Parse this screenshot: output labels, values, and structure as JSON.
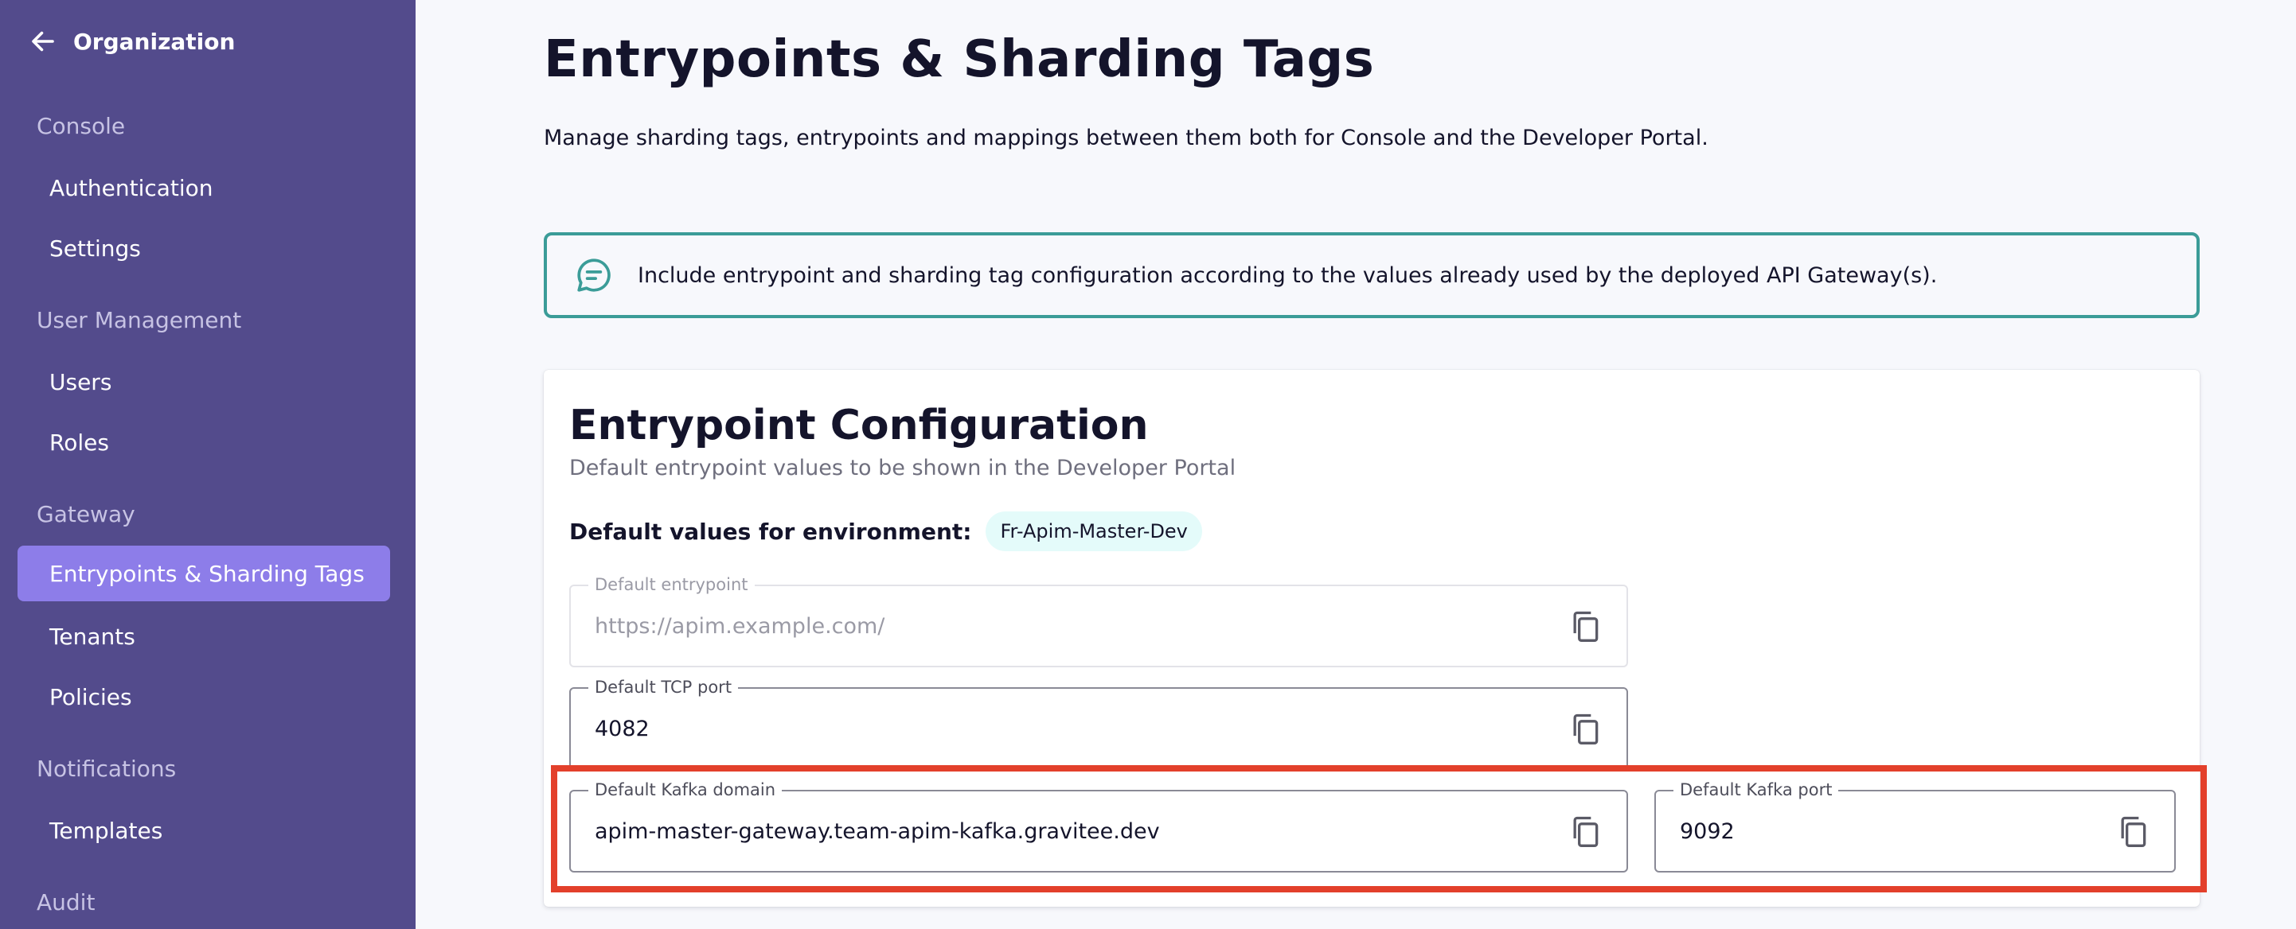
{
  "sidebar": {
    "back_label": "Organization",
    "sections": [
      {
        "title": "Console",
        "items": [
          "Authentication",
          "Settings"
        ]
      },
      {
        "title": "User Management",
        "items": [
          "Users",
          "Roles"
        ]
      },
      {
        "title": "Gateway",
        "items": [
          "Entrypoints & Sharding Tags",
          "Tenants",
          "Policies"
        ]
      },
      {
        "title": "Notifications",
        "items": [
          "Templates"
        ]
      },
      {
        "title": "Audit",
        "items": []
      }
    ],
    "active_item": "Entrypoints & Sharding Tags"
  },
  "page": {
    "title": "Entrypoints & Sharding Tags",
    "description": "Manage sharding tags, entrypoints and mappings between them both for Console and the Developer Portal."
  },
  "banner": {
    "text": "Include entrypoint and sharding tag configuration according to the values already used by the deployed API Gateway(s).",
    "icon": "chat-bubble-icon"
  },
  "card": {
    "title": "Entrypoint Configuration",
    "subtitle": "Default entrypoint values to be shown in the Developer Portal",
    "env_label": "Default values for environment:",
    "env_value": "Fr-Apim-Master-Dev",
    "fields": {
      "default_entrypoint": {
        "label": "Default entrypoint",
        "value": "https://apim.example.com/",
        "disabled": true
      },
      "tcp_port": {
        "label": "Default TCP port",
        "value": "4082"
      },
      "kafka_domain": {
        "label": "Default Kafka domain",
        "value": "apim-master-gateway.team-apim-kafka.gravitee.dev"
      },
      "kafka_port": {
        "label": "Default Kafka port",
        "value": "9092"
      }
    }
  },
  "colors": {
    "sidebar_bg": "#534b8c",
    "active_item_bg": "#8d7de9",
    "banner_border": "#3b9c98",
    "chip_bg": "#e4fbfa",
    "highlight": "#e3402b"
  }
}
